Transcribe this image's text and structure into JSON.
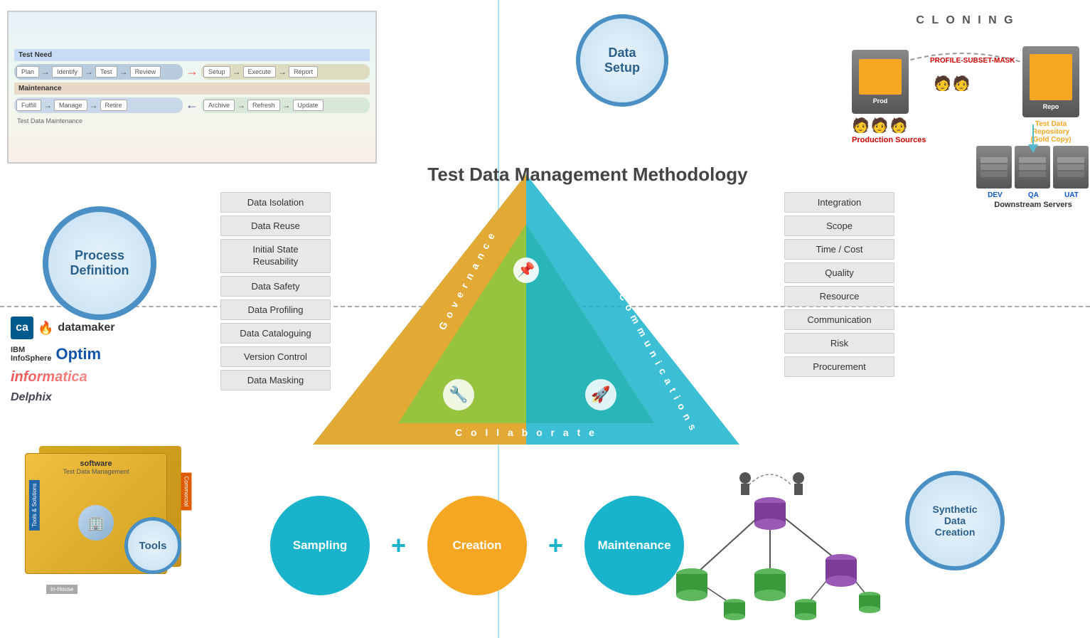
{
  "title": "Test Data Management  Methodology",
  "circles": {
    "data_setup": "Data\nSetup",
    "process_definition": "Process\nDefinition",
    "synthetic_data": "Synthetic\nData\nCreation",
    "tools": "Tools",
    "sampling": "Sampling",
    "creation": "Creation",
    "maintenance": "Maintenance"
  },
  "left_list": [
    "Data Isolation",
    "Data Reuse",
    "Initial State\nReusability",
    "Data Safety",
    "Data Profiling",
    "Data Cataloguing",
    "Version Control",
    "Data Masking"
  ],
  "right_list": [
    "Integration",
    "Scope",
    "Time / Cost",
    "Quality",
    "Resource",
    "Communication",
    "Risk",
    "Procurement"
  ],
  "triangle_labels": {
    "governance": "G o v e r n a n c e",
    "communications": "C o m m u n i c a t i o n s",
    "collaborate": "C o l l a b o r a t e"
  },
  "cloning": {
    "label": "C L O N I N G",
    "left_label": "Production\nSources",
    "middle_label": "PROFILE-SUBSET-MASK",
    "right_label": "Test Data\nRepository\n(Gold Copy)"
  },
  "downstream": {
    "labels": [
      "DEV",
      "QA",
      "UAT"
    ],
    "title": "Downstream\nServers"
  },
  "logos": {
    "ca_datamaker": "CA Datamaker",
    "ibm_optim": "IBM InfoSphere Optim",
    "informatica": "Informatica",
    "delphix": "Delphix"
  },
  "tools_box": {
    "line1": "software",
    "line2": "Test Data Management",
    "left_label1": "Tools & Solutions",
    "left_label2": "Commercial",
    "bottom_label": "In-House"
  },
  "colors": {
    "teal": "#1ab3cc",
    "orange": "#f5a623",
    "blue": "#4a90c4",
    "green_tri": "#8dc63f",
    "orange_tri": "#f5a623",
    "teal_tri": "#1ab3cc"
  }
}
